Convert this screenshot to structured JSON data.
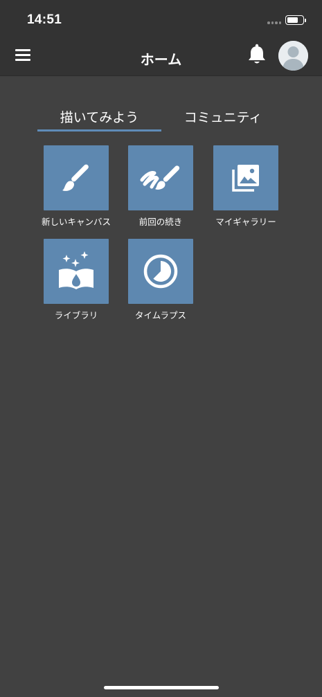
{
  "status_bar": {
    "time": "14:51",
    "battery_level": 0.72
  },
  "nav": {
    "title": "ホーム",
    "menu_icon": "hamburger-menu-icon",
    "bell_icon": "bell-icon",
    "avatar_icon": "user-avatar-icon"
  },
  "tabs": [
    {
      "label": "描いてみよう",
      "active": true
    },
    {
      "label": "コミュニティ",
      "active": false
    }
  ],
  "tiles": [
    {
      "label": "新しいキャンバス",
      "icon": "brush-icon"
    },
    {
      "label": "前回の続き",
      "icon": "brush-stroke-icon"
    },
    {
      "label": "マイギャラリー",
      "icon": "gallery-icon"
    },
    {
      "label": "ライブラリ",
      "icon": "library-book-icon"
    },
    {
      "label": "タイムラプス",
      "icon": "timelapse-icon"
    }
  ],
  "colors": {
    "background": "#414141",
    "header": "#333333",
    "tile": "#5e88b0",
    "tab_underline": "#5f8cb8"
  }
}
